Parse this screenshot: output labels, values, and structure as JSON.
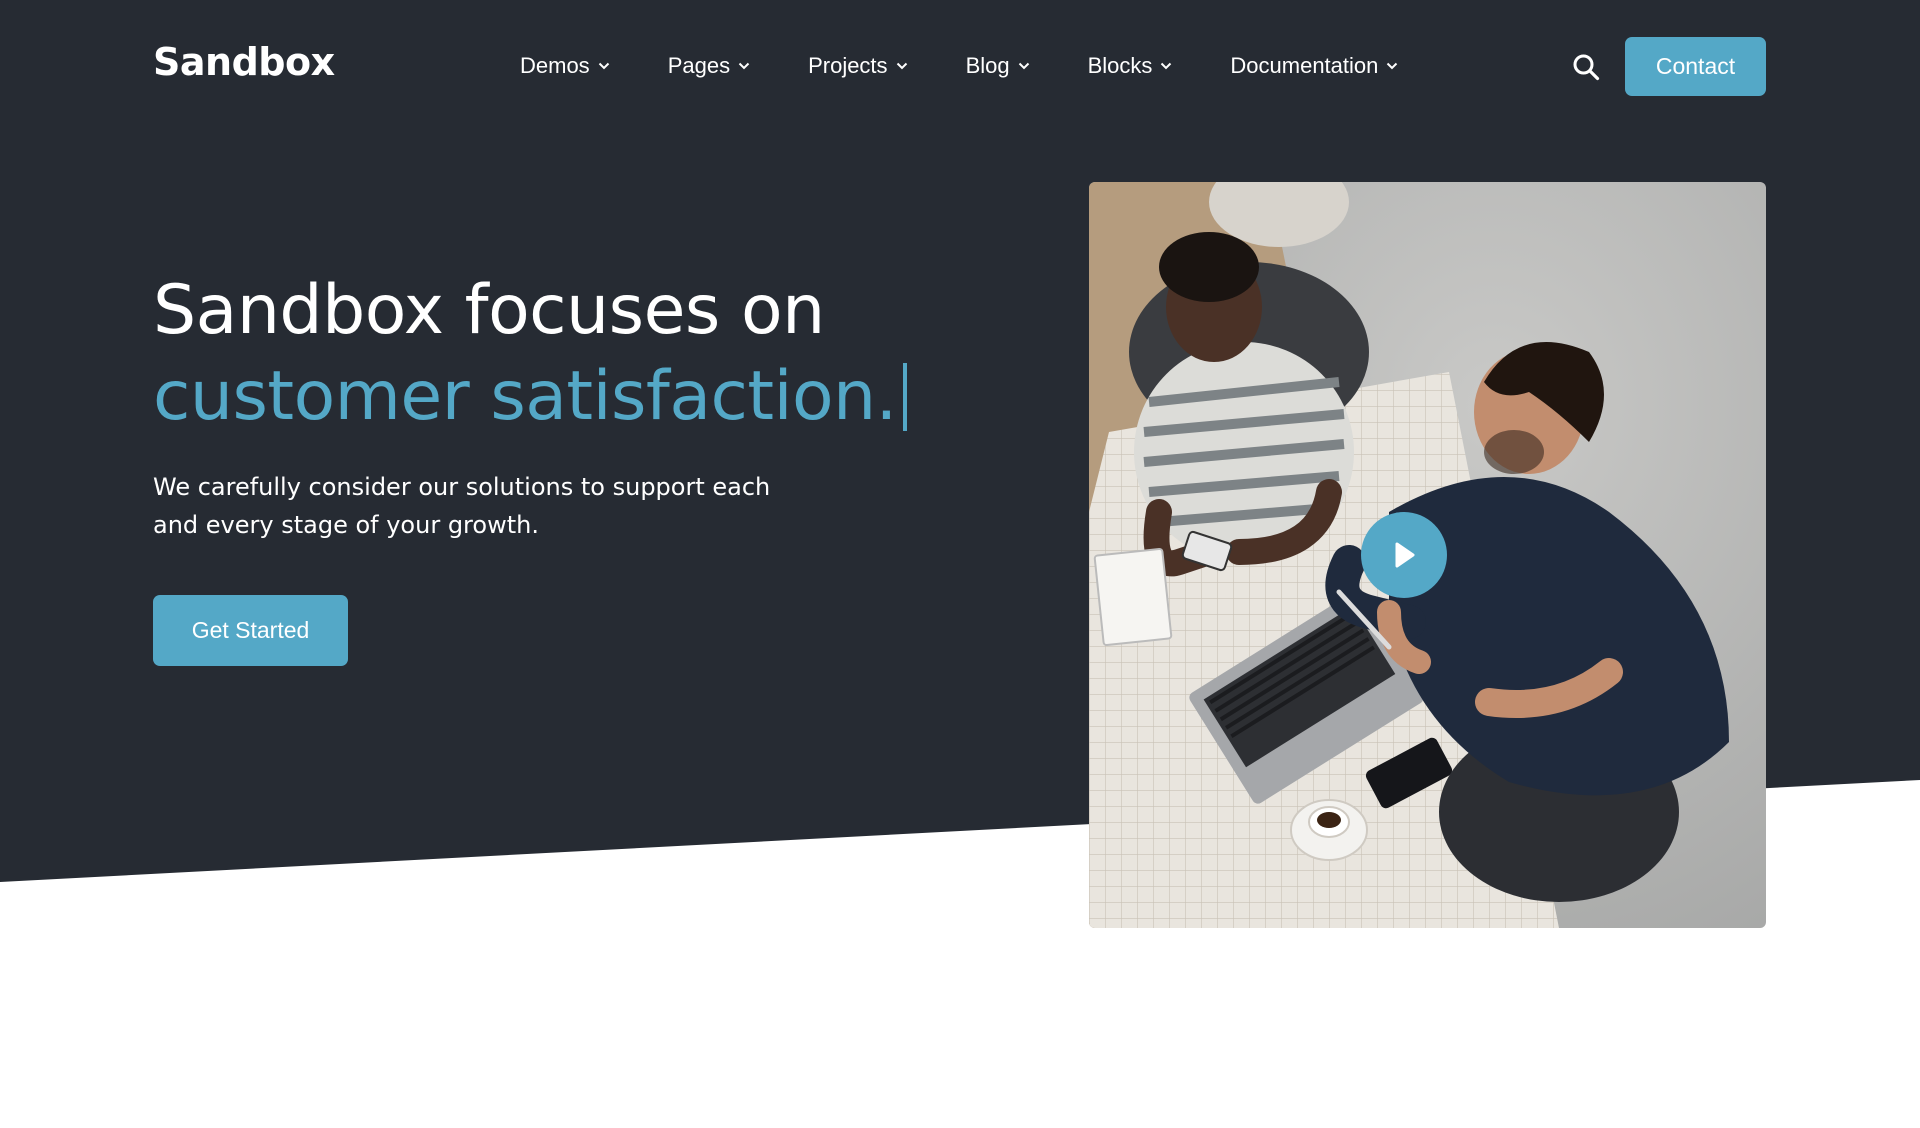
{
  "brand": {
    "name": "Sandbox"
  },
  "nav": {
    "items": [
      {
        "label": "Demos"
      },
      {
        "label": "Pages"
      },
      {
        "label": "Projects"
      },
      {
        "label": "Blog"
      },
      {
        "label": "Blocks"
      },
      {
        "label": "Documentation"
      }
    ],
    "search_icon": "search-icon",
    "contact_label": "Contact"
  },
  "hero": {
    "title_line1": "Sandbox focuses on",
    "title_line2": "customer satisfaction.",
    "subtitle": "We carefully consider our solutions to support each and every stage of your growth.",
    "cta_label": "Get Started",
    "media_icon": "play-icon"
  },
  "colors": {
    "background_dark": "#262b33",
    "accent": "#54a8c7",
    "text_light": "#ffffff",
    "page_bg": "#ffffff"
  }
}
